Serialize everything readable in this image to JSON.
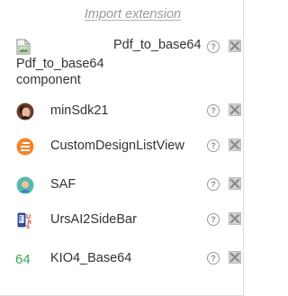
{
  "import_extension_label": "Import extension",
  "components": [
    {
      "name": "Pdf_to_base64",
      "icon": "broken-image-icon",
      "alt_text": "Pdf_to_base64 component"
    },
    {
      "name": "minSdk21",
      "icon": "avatar-photo-icon"
    },
    {
      "name": "CustomDesignListView",
      "icon": "custom-design-orange-icon"
    },
    {
      "name": "SAF",
      "icon": "avatar-person-icon"
    },
    {
      "name": "UrsAI2SideBar",
      "icon": "sidebar-phone-icon"
    },
    {
      "name": "KIO4_Base64",
      "icon": "number-64-icon",
      "icon_text": "64"
    }
  ],
  "help_symbol": "?",
  "colors": {
    "link": "#9a9a9a",
    "text": "#333333",
    "delete_button_bg": "#d2d2d2",
    "orange_icon": "#f5832a",
    "kio4_green": "#3aa655"
  }
}
